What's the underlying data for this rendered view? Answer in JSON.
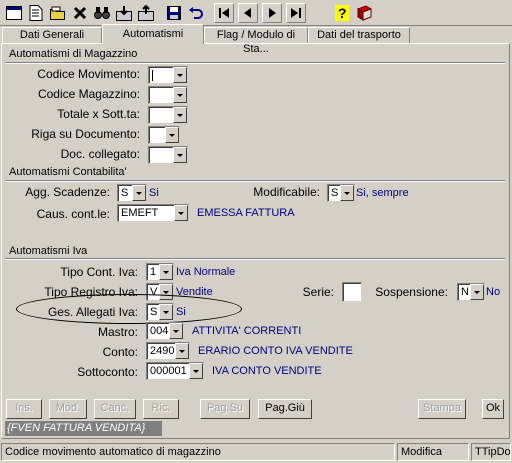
{
  "toolbar": {
    "icons": [
      "window-icon",
      "new-document-icon",
      "open-folder-icon",
      "delete-icon",
      "binoculars-icon",
      "import-icon",
      "export-icon",
      "save-icon",
      "undo-icon",
      "first-record-icon",
      "previous-record-icon",
      "next-record-icon",
      "last-record-icon",
      "help-icon",
      "book-icon"
    ]
  },
  "tabs": [
    {
      "label": "Dati Generali"
    },
    {
      "label": "Automatismi"
    },
    {
      "label": "Flag / Modulo di Sta..."
    },
    {
      "label": "Dati del trasporto"
    }
  ],
  "magazzino": {
    "title": "Automatismi di Magazzino",
    "codice_movimento": {
      "label": "Codice Movimento:",
      "value": ""
    },
    "codice_magazzino": {
      "label": "Codice Magazzino:",
      "value": ""
    },
    "totale": {
      "label": "Totale x Sott.ta:",
      "value": ""
    },
    "riga": {
      "label": "Riga su Documento:",
      "value": ""
    },
    "doc": {
      "label": "Doc. collegato:",
      "value": ""
    }
  },
  "contabilita": {
    "title": "Automatismi Contabilita'",
    "agg_scadenze": {
      "label": "Agg. Scadenze:",
      "value": "S",
      "desc": "Si"
    },
    "modificabile": {
      "label": "Modificabile:",
      "value": "S",
      "desc": "Si, sempre"
    },
    "caus": {
      "label": "Caus. cont.le:",
      "value": "EMEFT",
      "desc": "EMESSA FATTURA"
    }
  },
  "iva": {
    "title": "Automatismi Iva",
    "tipo_cont": {
      "label": "Tipo Cont. Iva:",
      "value": "1",
      "desc": "Iva Normale"
    },
    "tipo_registro": {
      "label": "Tipo Registro Iva:",
      "value": "V",
      "desc": "Vendite"
    },
    "serie": {
      "label": "Serie:",
      "value": ""
    },
    "sospensione": {
      "label": "Sospensione:",
      "value": "N",
      "desc": "No"
    },
    "ges_allegati": {
      "label": "Ges. Allegati Iva:",
      "value": "S",
      "desc": "Si"
    },
    "mastro": {
      "label": "Mastro:",
      "value": "004",
      "desc": "ATTIVITA' CORRENTI"
    },
    "conto": {
      "label": "Conto:",
      "value": "2490",
      "desc": "ERARIO CONTO IVA VENDITE"
    },
    "sottoconto": {
      "label": "Sottoconto:",
      "value": "000001",
      "desc": "IVA CONTO VENDITE"
    }
  },
  "buttons": {
    "ins": "Ins.",
    "mod": "Mod.",
    "canc": "Canc.",
    "ric": "Ric.",
    "pagsu": "Pag.Su",
    "paggiu": "Pag.Giù",
    "stampa": "Stampa",
    "ok": "Ok"
  },
  "record_caption": "{FVEN FATTURA VENDITA}",
  "statusbar": {
    "message": "Codice movimento automatico di magazzino",
    "mode": "Modifica",
    "field": "TTipDoc"
  },
  "colors": {
    "face": "#d4d0c8",
    "desc_text": "#000080",
    "caption_bg": "#808080"
  }
}
